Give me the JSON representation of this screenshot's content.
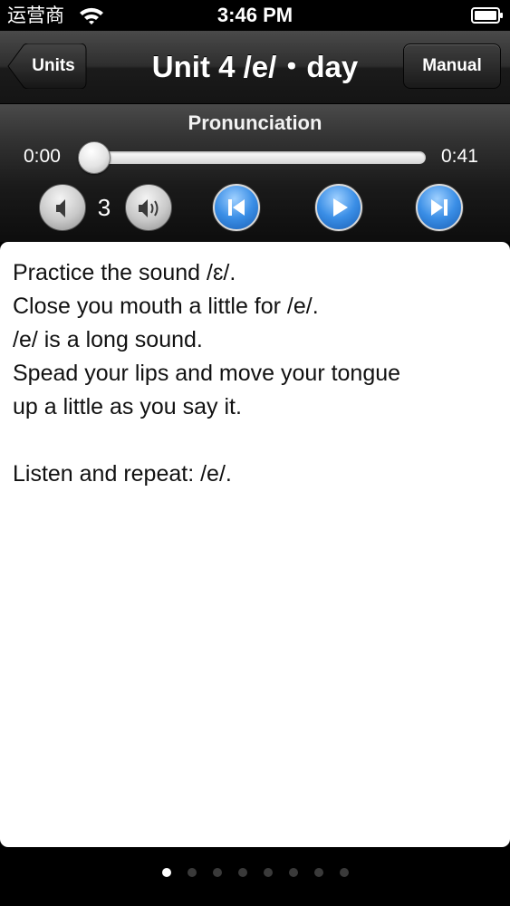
{
  "status_bar": {
    "carrier": "运营商",
    "time": "3:46 PM",
    "icons": [
      "wifi-icon",
      "battery-icon"
    ]
  },
  "nav_bar": {
    "back_label": "Units",
    "title": "Unit 4 /e/・day",
    "right_label": "Manual"
  },
  "player": {
    "title": "Pronunciation",
    "time_start": "0:00",
    "time_end": "0:41",
    "progress_fraction": 0,
    "volume_level": "3",
    "icons": [
      "volume-down-icon",
      "volume-up-icon",
      "skip-previous-icon",
      "play-icon",
      "skip-next-icon"
    ],
    "accent_color": "#2f86e0"
  },
  "content": {
    "lines": [
      "Practice the sound /ɛ/.",
      "Close you mouth a little for /e/.",
      "/e/ is a long sound.",
      "Spead your lips and move your tongue",
      "up a little as you say it.",
      "",
      "Listen and repeat: /e/."
    ]
  },
  "pager": {
    "page_count": 8,
    "current_page": 1
  }
}
